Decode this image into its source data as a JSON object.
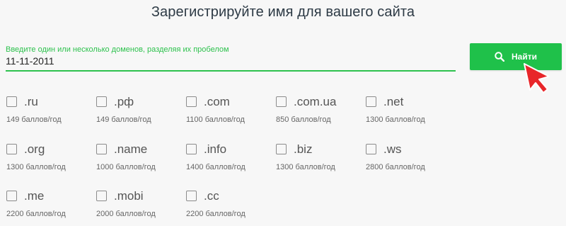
{
  "header": {
    "title": "Зарегистрируйте имя для вашего сайта"
  },
  "search": {
    "label": "Введите один или несколько доменов, разделяя их пробелом",
    "value": "11-11-2011",
    "button_label": "Найти"
  },
  "colors": {
    "accent": "#1fc14a",
    "cursor": "#e8262a"
  },
  "icons": {
    "search": "search-icon",
    "pointer": "cursor-icon",
    "checkbox": "checkbox-icon"
  },
  "tlds": [
    {
      "name": ".ru",
      "price": "149 баллов/год"
    },
    {
      "name": ".рф",
      "price": "149 баллов/год"
    },
    {
      "name": ".com",
      "price": "1100 баллов/год"
    },
    {
      "name": ".com.ua",
      "price": "850 баллов/год"
    },
    {
      "name": ".net",
      "price": "1300 баллов/год"
    },
    {
      "name": ".org",
      "price": "1300 баллов/год"
    },
    {
      "name": ".name",
      "price": "1000 баллов/год"
    },
    {
      "name": ".info",
      "price": "1400 баллов/год"
    },
    {
      "name": ".biz",
      "price": "1300 баллов/год"
    },
    {
      "name": ".ws",
      "price": "2800 баллов/год"
    },
    {
      "name": ".me",
      "price": "2200 баллов/год"
    },
    {
      "name": ".mobi",
      "price": "2000 баллов/год"
    },
    {
      "name": ".cc",
      "price": "2200 баллов/год"
    }
  ]
}
